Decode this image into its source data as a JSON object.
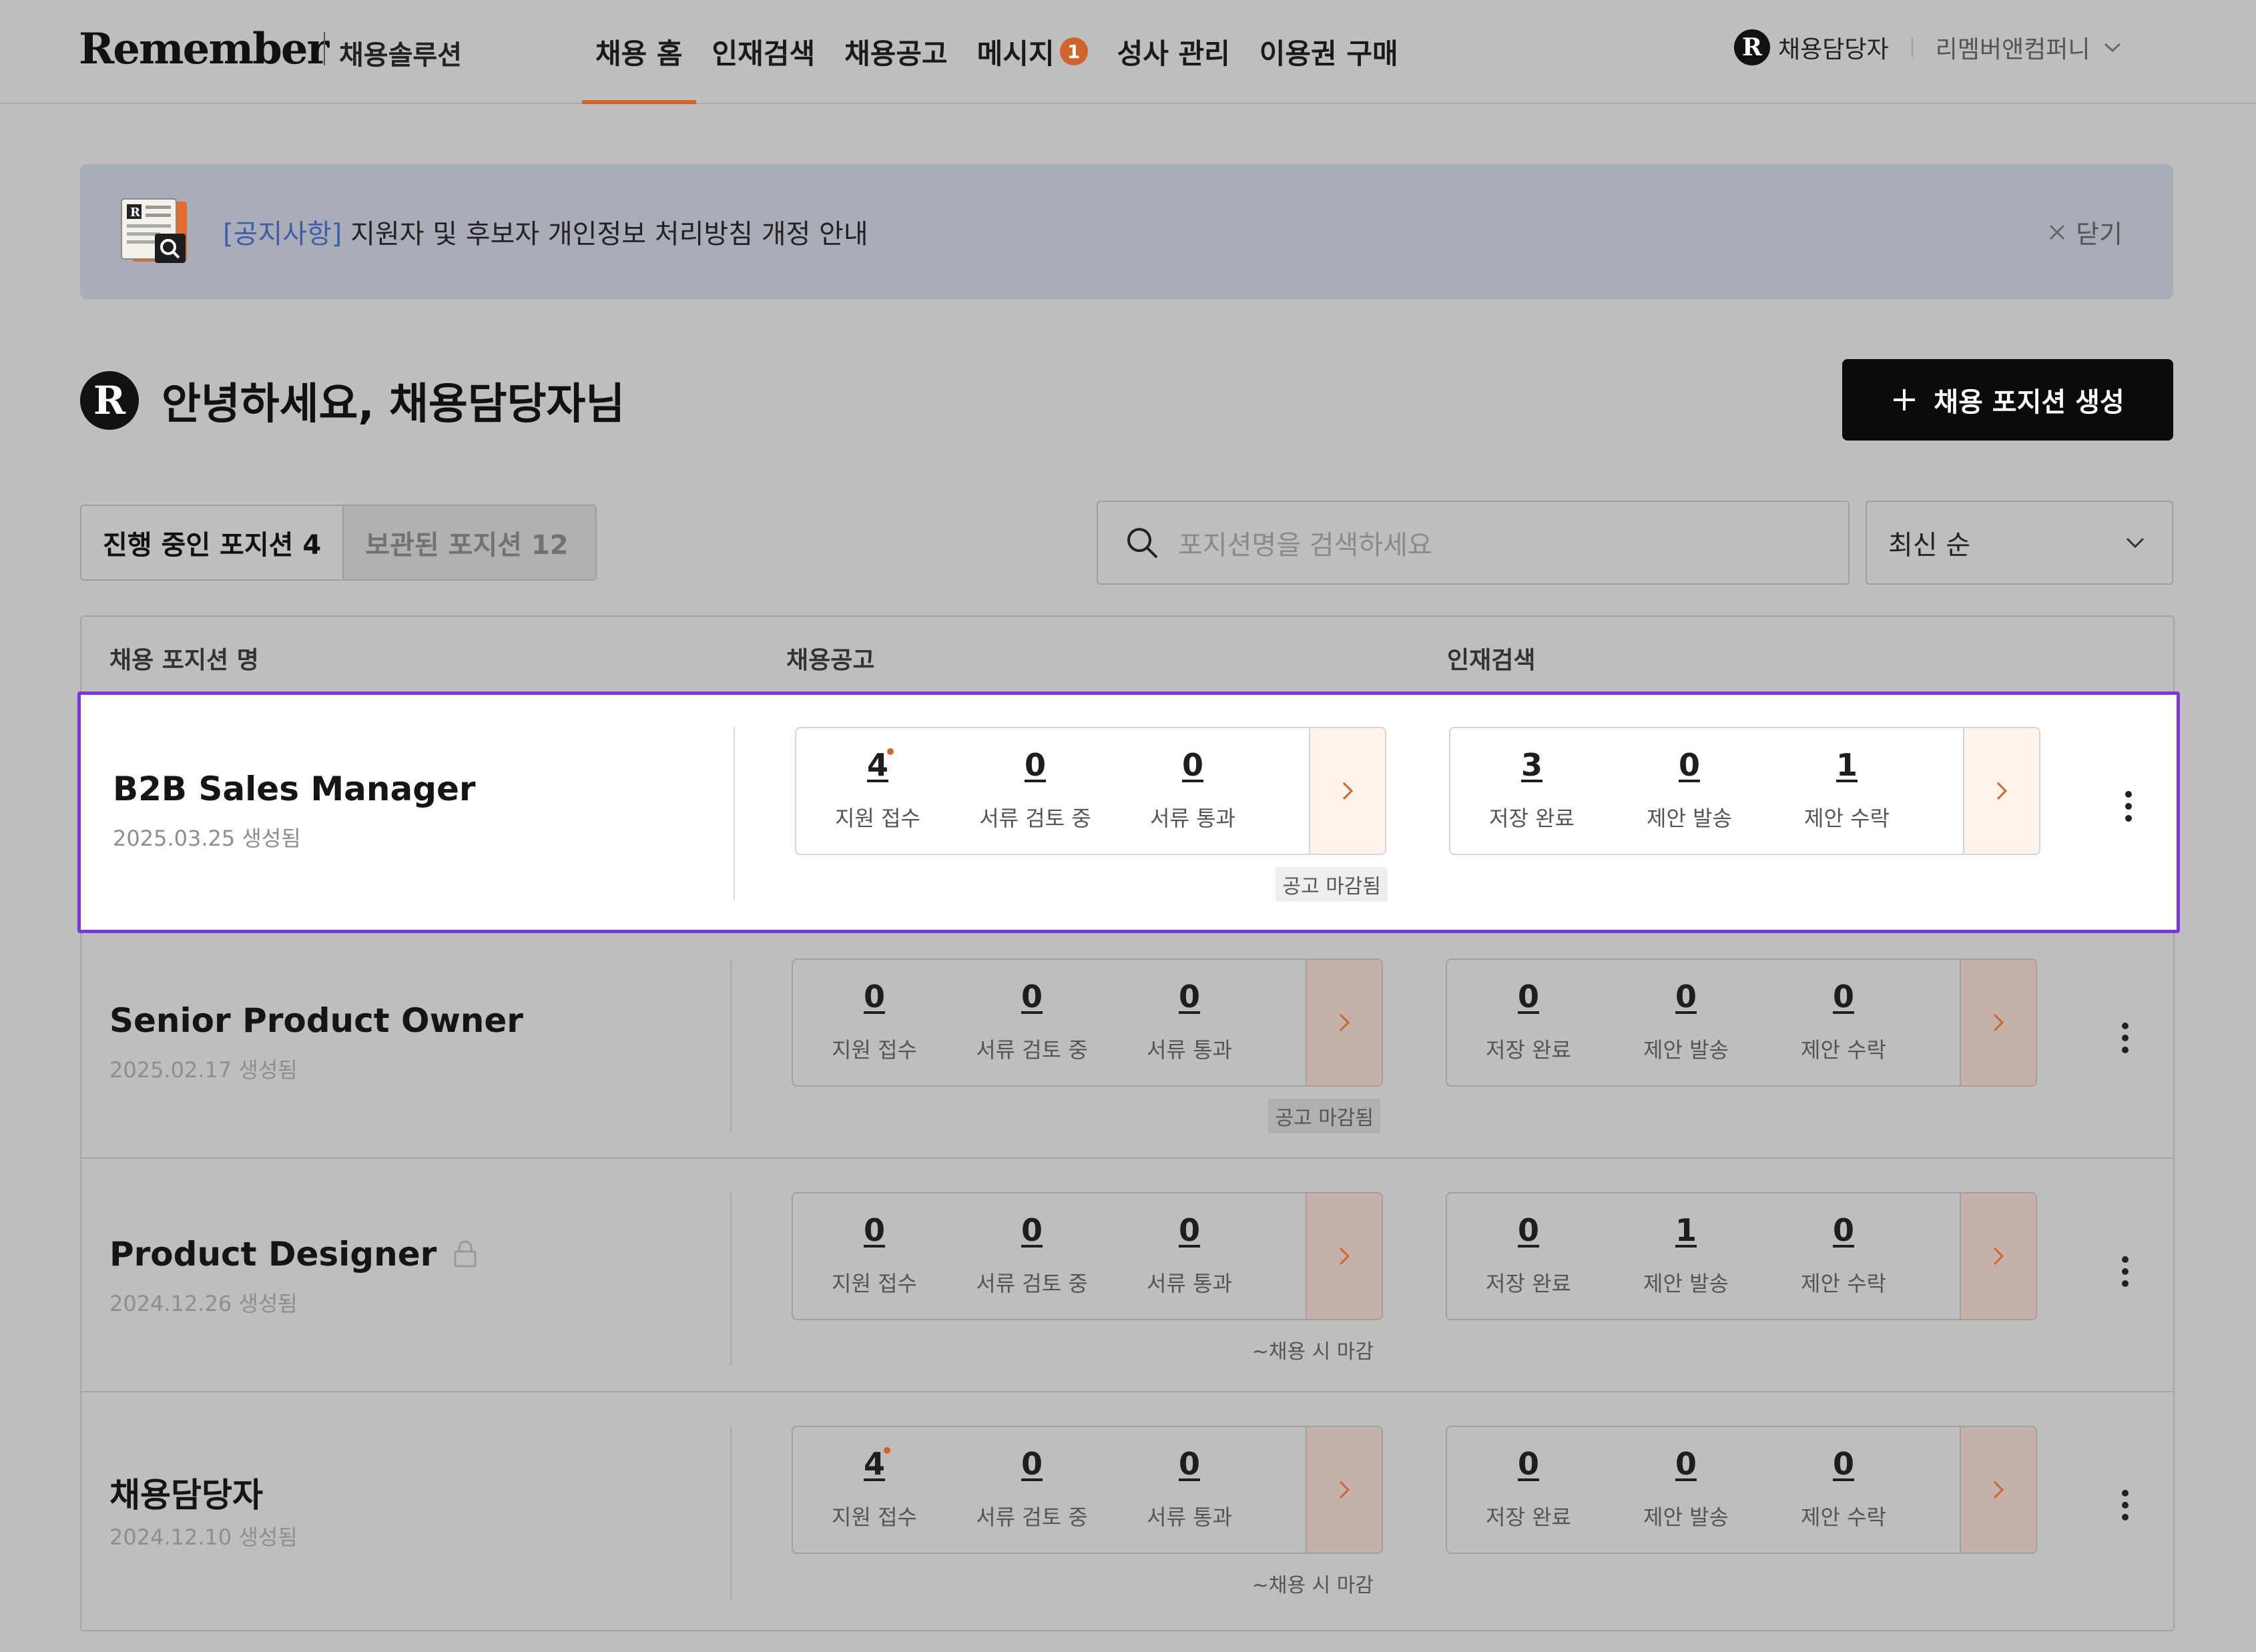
{
  "header": {
    "logo": "Remember",
    "logo_sub": "채용솔루션",
    "nav": [
      {
        "label": "채용 홈",
        "active": true
      },
      {
        "label": "인재검색"
      },
      {
        "label": "채용공고"
      },
      {
        "label": "메시지",
        "badge": "1"
      },
      {
        "label": "성사 관리"
      },
      {
        "label": "이용권 구매"
      }
    ],
    "user": {
      "role": "채용담당자",
      "company": "리멤버앤컴퍼니"
    }
  },
  "notice": {
    "tag": "[공지사항]",
    "text": " 지원자 및 후보자 개인정보 처리방침 개정 안내",
    "close": "닫기"
  },
  "greeting": "안녕하세요, 채용담당자님",
  "create_button": "채용 포지션 생성",
  "tabs": [
    {
      "label": "진행 중인 포지션 4"
    },
    {
      "label": "보관된 포지션 12"
    }
  ],
  "search": {
    "placeholder": "포지션명을 검색하세요"
  },
  "sort": {
    "value": "최신 순"
  },
  "table": {
    "headers": [
      "채용 포지션 명",
      "채용공고",
      "인재검색"
    ],
    "job_labels": [
      "지원 접수",
      "서류 검토 중",
      "서류 통과"
    ],
    "talent_labels": [
      "저장 완료",
      "제안 발송",
      "제안 수락"
    ],
    "rows": [
      {
        "name": "B2B Sales Manager",
        "date": "2025.03.25 생성됨",
        "job": [
          "4",
          "0",
          "0"
        ],
        "job_new": true,
        "talent": [
          "3",
          "0",
          "1"
        ],
        "deadline": "공고 마감됨",
        "deadline_tag": true,
        "locked": false
      },
      {
        "name": "Senior Product Owner",
        "date": "2025.02.17 생성됨",
        "job": [
          "0",
          "0",
          "0"
        ],
        "job_new": false,
        "talent": [
          "0",
          "0",
          "0"
        ],
        "deadline": "공고 마감됨",
        "deadline_tag": true,
        "locked": false
      },
      {
        "name": "Product Designer",
        "date": "2024.12.26 생성됨",
        "job": [
          "0",
          "0",
          "0"
        ],
        "job_new": false,
        "talent": [
          "0",
          "1",
          "0"
        ],
        "deadline": "~채용 시 마감",
        "deadline_tag": false,
        "locked": true
      },
      {
        "name": "채용담당자",
        "date": "2024.12.10 생성됨",
        "job": [
          "4",
          "0",
          "0"
        ],
        "job_new": true,
        "talent": [
          "0",
          "0",
          "0"
        ],
        "deadline": "~채용 시 마감",
        "deadline_tag": false,
        "locked": false
      }
    ]
  },
  "colors": {
    "accent": "#d0642a",
    "highlight": "#7a36e0"
  }
}
